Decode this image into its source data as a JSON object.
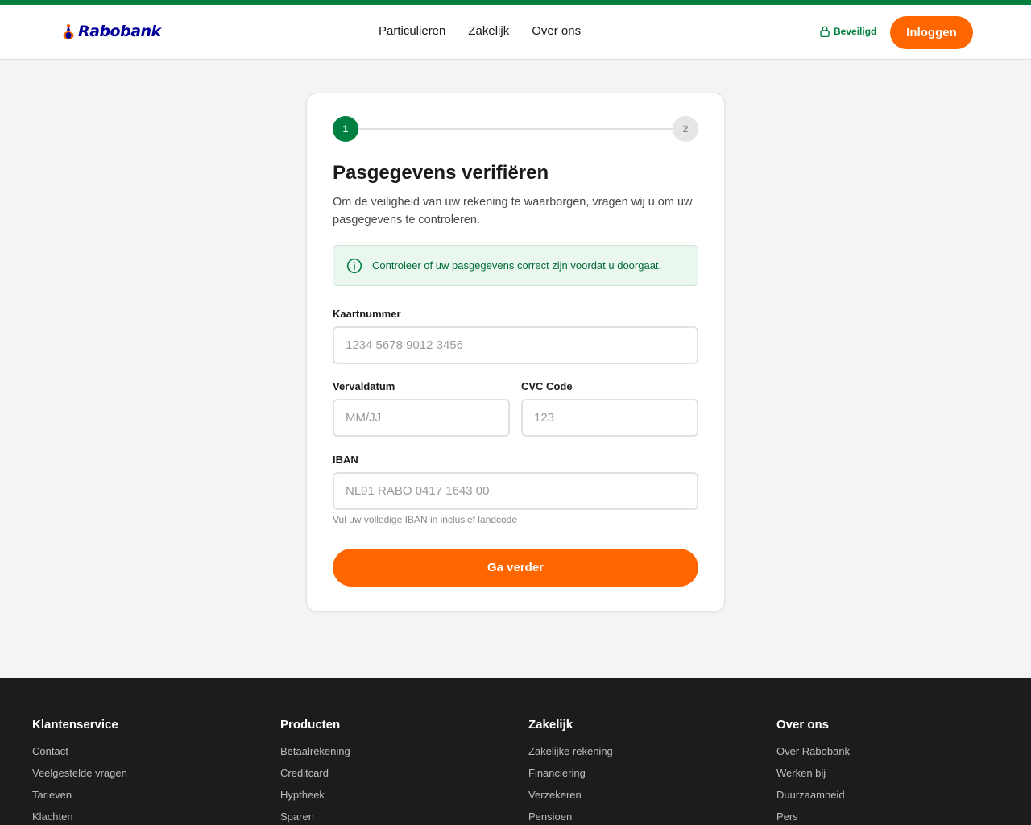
{
  "header": {
    "logo_text": "Rabobank",
    "nav": [
      "Particulieren",
      "Zakelijk",
      "Over ons"
    ],
    "secure_label": "Beveiligd",
    "login_label": "Inloggen"
  },
  "colors": {
    "brand_green": "#008040",
    "accent_orange": "#ff6600",
    "logo_blue": "#000099"
  },
  "form": {
    "steps": [
      "1",
      "2"
    ],
    "current_step": 1,
    "title": "Pasgegevens verifiëren",
    "intro": "Om de veiligheid van uw rekening te waarborgen, vragen wij u om uw pasgegevens te controleren.",
    "notice": "Controleer of uw pasgegevens correct zijn voordat u doorgaat.",
    "card_number": {
      "label": "Kaartnummer",
      "placeholder": "1234 5678 9012 3456",
      "value": ""
    },
    "expiry": {
      "label": "Vervaldatum",
      "placeholder": "MM/JJ",
      "value": ""
    },
    "cvc": {
      "label": "CVC Code",
      "placeholder": "123",
      "value": ""
    },
    "iban": {
      "label": "IBAN",
      "placeholder": "NL91 RABO 0417 1643 00",
      "value": "",
      "hint": "Vul uw volledige IBAN in inclusief landcode"
    },
    "submit_label": "Ga verder"
  },
  "footer": {
    "columns": [
      {
        "title": "Klantenservice",
        "links": [
          "Contact",
          "Veelgestelde vragen",
          "Tarieven",
          "Klachten"
        ]
      },
      {
        "title": "Producten",
        "links": [
          "Betaalrekening",
          "Creditcard",
          "Hyptheek",
          "Sparen"
        ]
      },
      {
        "title": "Zakelijk",
        "links": [
          "Zakelijke rekening",
          "Financiering",
          "Verzekeren",
          "Pensioen"
        ]
      },
      {
        "title": "Over ons",
        "links": [
          "Over Rabobank",
          "Werken bij",
          "Duurzaamheid",
          "Pers"
        ]
      }
    ]
  }
}
